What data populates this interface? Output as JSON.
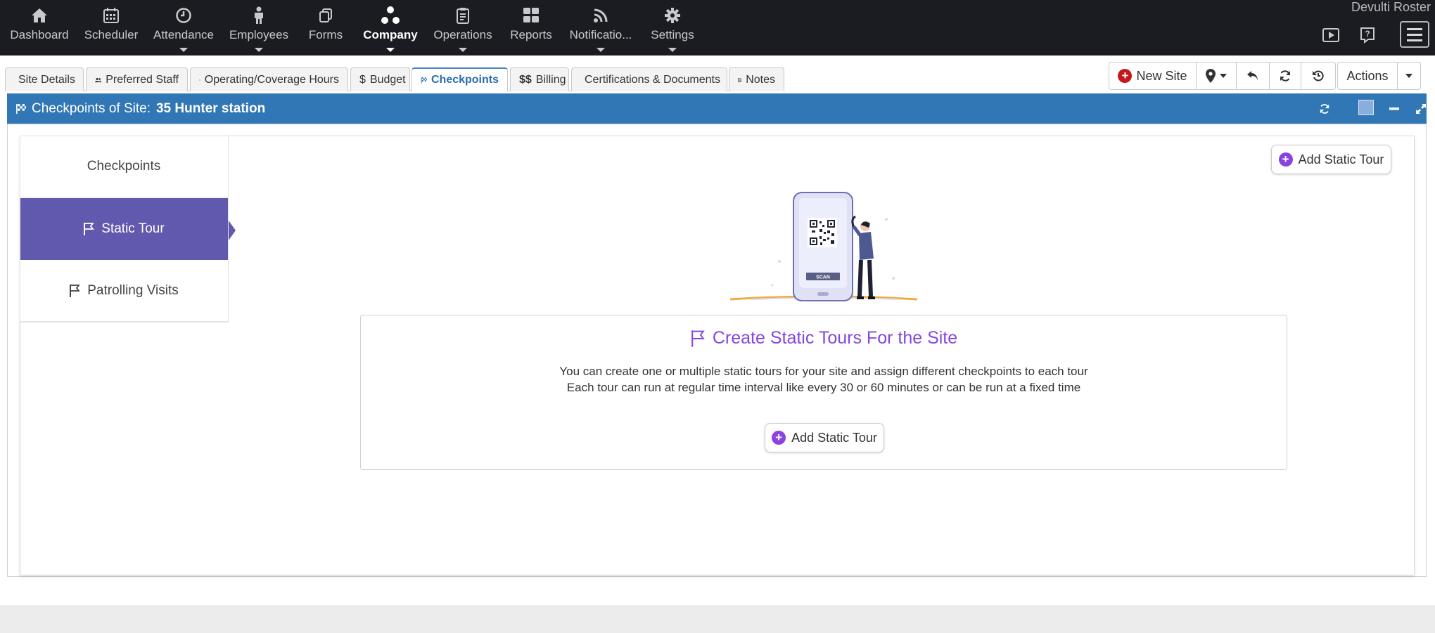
{
  "app": {
    "title": "Devulti Roster"
  },
  "nav": {
    "items": [
      {
        "label": "Dashboard",
        "icon": "home-icon"
      },
      {
        "label": "Scheduler",
        "icon": "calendar-icon"
      },
      {
        "label": "Attendance",
        "icon": "clock-icon"
      },
      {
        "label": "Employees",
        "icon": "person-icon"
      },
      {
        "label": "Forms",
        "icon": "copy-icon"
      },
      {
        "label": "Company",
        "icon": "company-icon"
      },
      {
        "label": "Operations",
        "icon": "clipboard-icon"
      },
      {
        "label": "Reports",
        "icon": "grid-icon"
      },
      {
        "label": "Notificatio...",
        "icon": "rss-icon"
      },
      {
        "label": "Settings",
        "icon": "gear-icon"
      }
    ],
    "active": "Company"
  },
  "tabs": [
    {
      "label": "Site Details"
    },
    {
      "label": "Preferred Staff"
    },
    {
      "label": "Operating/Coverage Hours"
    },
    {
      "label": "Budget"
    },
    {
      "label": "Checkpoints"
    },
    {
      "label": "Billing"
    },
    {
      "label": "Certifications & Documents"
    },
    {
      "label": "Notes"
    }
  ],
  "toolbar": {
    "new_site_label": "New Site",
    "actions_label": "Actions"
  },
  "panel": {
    "title_prefix": "Checkpoints of Site:",
    "site_name": "35 Hunter station"
  },
  "sidebar": {
    "items": [
      {
        "label": "Checkpoints"
      },
      {
        "label": "Static Tour"
      },
      {
        "label": "Patrolling Visits"
      }
    ],
    "active": "Static Tour"
  },
  "main": {
    "add_static_tour_top": "Add Static Tour",
    "illustration_scan_label": "SCAN",
    "info_title": "Create Static Tours For the Site",
    "info_line1": "You can create one or multiple static tours for your site and assign different checkpoints to each tour",
    "info_line2": "Each tour can run at regular time interval like every 30 or 60 minutes or can be run at a fixed time",
    "add_static_tour_bottom": "Add Static Tour"
  },
  "colors": {
    "nav_bg": "#1b1c21",
    "panel_header": "#3277b5",
    "sidebar_active": "#6159ad",
    "accent_purple": "#8647de",
    "new_site_red": "#c5181d"
  }
}
